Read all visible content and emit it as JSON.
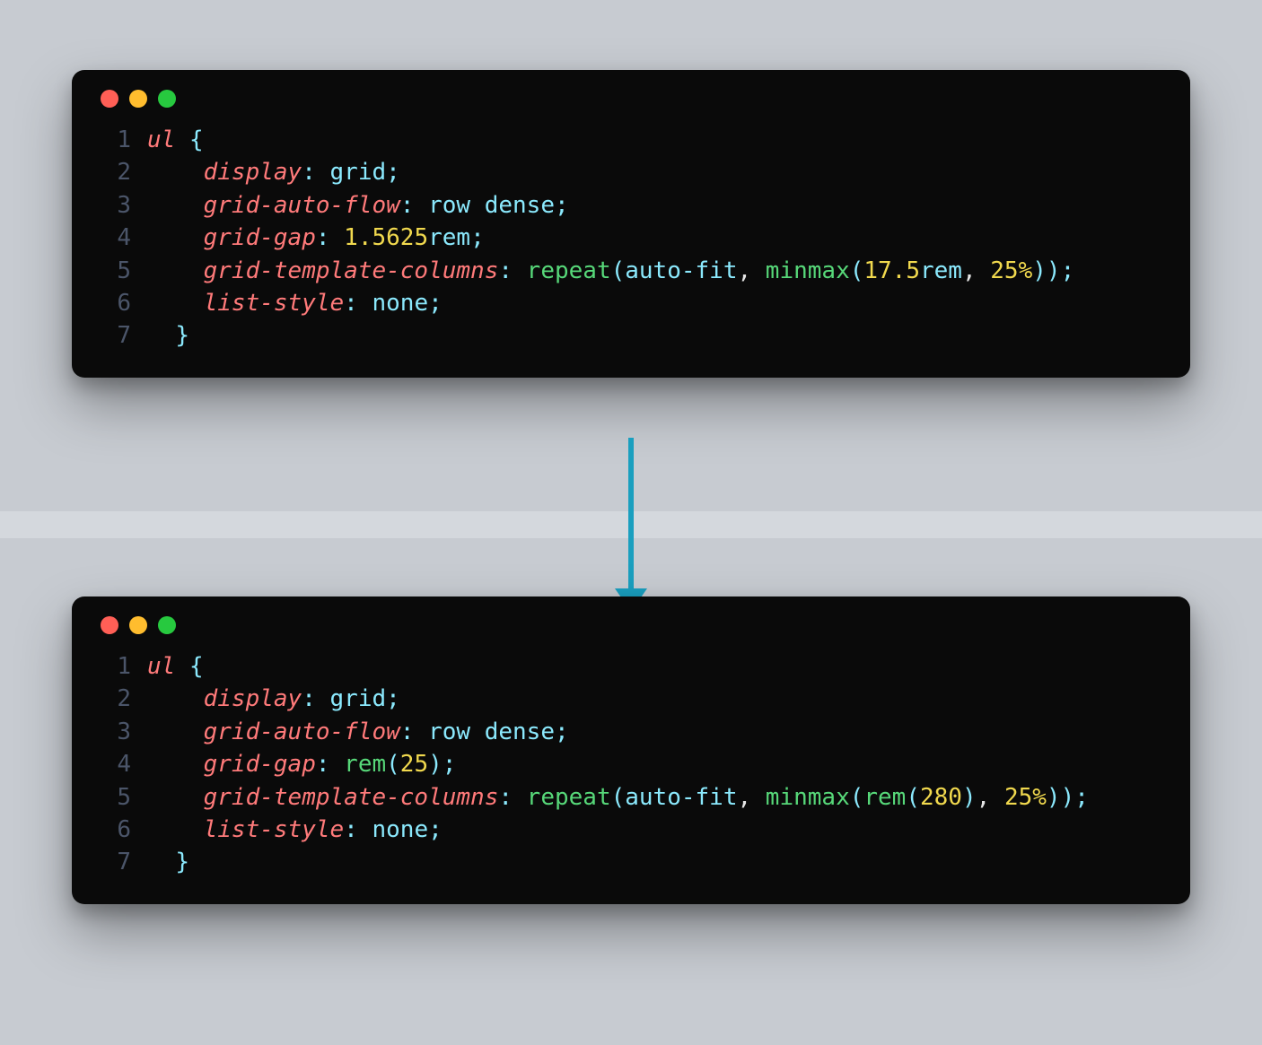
{
  "windows": {
    "top": {
      "lines": [
        {
          "n": "1",
          "tokens": [
            {
              "t": "ul",
              "c": "tk-sel"
            },
            {
              "t": " "
            },
            {
              "t": "{",
              "c": "tk-brace"
            }
          ]
        },
        {
          "n": "2",
          "tokens": [
            {
              "t": "    "
            },
            {
              "t": "display",
              "c": "tk-prop"
            },
            {
              "t": ":",
              "c": "tk-punc"
            },
            {
              "t": " "
            },
            {
              "t": "grid",
              "c": "tk-val"
            },
            {
              "t": ";",
              "c": "tk-semi"
            }
          ]
        },
        {
          "n": "3",
          "tokens": [
            {
              "t": "    "
            },
            {
              "t": "grid-auto-flow",
              "c": "tk-prop"
            },
            {
              "t": ":",
              "c": "tk-punc"
            },
            {
              "t": " "
            },
            {
              "t": "row dense",
              "c": "tk-val"
            },
            {
              "t": ";",
              "c": "tk-semi"
            }
          ]
        },
        {
          "n": "4",
          "tokens": [
            {
              "t": "    "
            },
            {
              "t": "grid-gap",
              "c": "tk-prop"
            },
            {
              "t": ":",
              "c": "tk-punc"
            },
            {
              "t": " "
            },
            {
              "t": "1.5625",
              "c": "tk-num"
            },
            {
              "t": "rem",
              "c": "tk-unit"
            },
            {
              "t": ";",
              "c": "tk-semi"
            }
          ]
        },
        {
          "n": "5",
          "tokens": [
            {
              "t": "    "
            },
            {
              "t": "grid-template-columns",
              "c": "tk-prop"
            },
            {
              "t": ":",
              "c": "tk-punc"
            },
            {
              "t": " "
            },
            {
              "t": "repeat",
              "c": "tk-fn"
            },
            {
              "t": "(",
              "c": "tk-punc"
            },
            {
              "t": "auto-fit",
              "c": "tk-val"
            },
            {
              "t": ",",
              "c": "tk-comma"
            },
            {
              "t": " "
            },
            {
              "t": "minmax",
              "c": "tk-fn2"
            },
            {
              "t": "(",
              "c": "tk-punc"
            },
            {
              "t": "17.5",
              "c": "tk-num"
            },
            {
              "t": "rem",
              "c": "tk-unit"
            },
            {
              "t": ",",
              "c": "tk-comma"
            },
            {
              "t": " "
            },
            {
              "t": "25%",
              "c": "tk-pct"
            },
            {
              "t": ")",
              "c": "tk-punc"
            },
            {
              "t": ")",
              "c": "tk-punc"
            },
            {
              "t": ";",
              "c": "tk-semi"
            }
          ]
        },
        {
          "n": "6",
          "tokens": [
            {
              "t": "    "
            },
            {
              "t": "list-style",
              "c": "tk-prop"
            },
            {
              "t": ":",
              "c": "tk-punc"
            },
            {
              "t": " "
            },
            {
              "t": "none",
              "c": "tk-val"
            },
            {
              "t": ";",
              "c": "tk-semi"
            }
          ]
        },
        {
          "n": "7",
          "tokens": [
            {
              "t": "  "
            },
            {
              "t": "}",
              "c": "tk-brace"
            }
          ]
        }
      ]
    },
    "bottom": {
      "lines": [
        {
          "n": "1",
          "tokens": [
            {
              "t": "ul",
              "c": "tk-sel"
            },
            {
              "t": " "
            },
            {
              "t": "{",
              "c": "tk-brace"
            }
          ]
        },
        {
          "n": "2",
          "tokens": [
            {
              "t": "    "
            },
            {
              "t": "display",
              "c": "tk-prop"
            },
            {
              "t": ":",
              "c": "tk-punc"
            },
            {
              "t": " "
            },
            {
              "t": "grid",
              "c": "tk-val"
            },
            {
              "t": ";",
              "c": "tk-semi"
            }
          ]
        },
        {
          "n": "3",
          "tokens": [
            {
              "t": "    "
            },
            {
              "t": "grid-auto-flow",
              "c": "tk-prop"
            },
            {
              "t": ":",
              "c": "tk-punc"
            },
            {
              "t": " "
            },
            {
              "t": "row dense",
              "c": "tk-val"
            },
            {
              "t": ";",
              "c": "tk-semi"
            }
          ]
        },
        {
          "n": "4",
          "tokens": [
            {
              "t": "    "
            },
            {
              "t": "grid-gap",
              "c": "tk-prop"
            },
            {
              "t": ":",
              "c": "tk-punc"
            },
            {
              "t": " "
            },
            {
              "t": "rem",
              "c": "tk-fn"
            },
            {
              "t": "(",
              "c": "tk-punc"
            },
            {
              "t": "25",
              "c": "tk-num"
            },
            {
              "t": ")",
              "c": "tk-punc"
            },
            {
              "t": ";",
              "c": "tk-semi"
            }
          ]
        },
        {
          "n": "5",
          "tokens": [
            {
              "t": "    "
            },
            {
              "t": "grid-template-columns",
              "c": "tk-prop"
            },
            {
              "t": ":",
              "c": "tk-punc"
            },
            {
              "t": " "
            },
            {
              "t": "repeat",
              "c": "tk-fn"
            },
            {
              "t": "(",
              "c": "tk-punc"
            },
            {
              "t": "auto-fit",
              "c": "tk-val"
            },
            {
              "t": ",",
              "c": "tk-comma"
            },
            {
              "t": " "
            },
            {
              "t": "minmax",
              "c": "tk-fn2"
            },
            {
              "t": "(",
              "c": "tk-punc"
            },
            {
              "t": "rem",
              "c": "tk-fn"
            },
            {
              "t": "(",
              "c": "tk-punc"
            },
            {
              "t": "280",
              "c": "tk-num"
            },
            {
              "t": ")",
              "c": "tk-punc"
            },
            {
              "t": ",",
              "c": "tk-comma"
            },
            {
              "t": " "
            },
            {
              "t": "25%",
              "c": "tk-pct"
            },
            {
              "t": ")",
              "c": "tk-punc"
            },
            {
              "t": ")",
              "c": "tk-punc"
            },
            {
              "t": ";",
              "c": "tk-semi"
            }
          ]
        },
        {
          "n": "6",
          "tokens": [
            {
              "t": "    "
            },
            {
              "t": "list-style",
              "c": "tk-prop"
            },
            {
              "t": ":",
              "c": "tk-punc"
            },
            {
              "t": " "
            },
            {
              "t": "none",
              "c": "tk-val"
            },
            {
              "t": ";",
              "c": "tk-semi"
            }
          ]
        },
        {
          "n": "7",
          "tokens": [
            {
              "t": "  "
            },
            {
              "t": "}",
              "c": "tk-brace"
            }
          ]
        }
      ]
    }
  },
  "colors": {
    "accent_arrow": "#1a9fbf"
  }
}
